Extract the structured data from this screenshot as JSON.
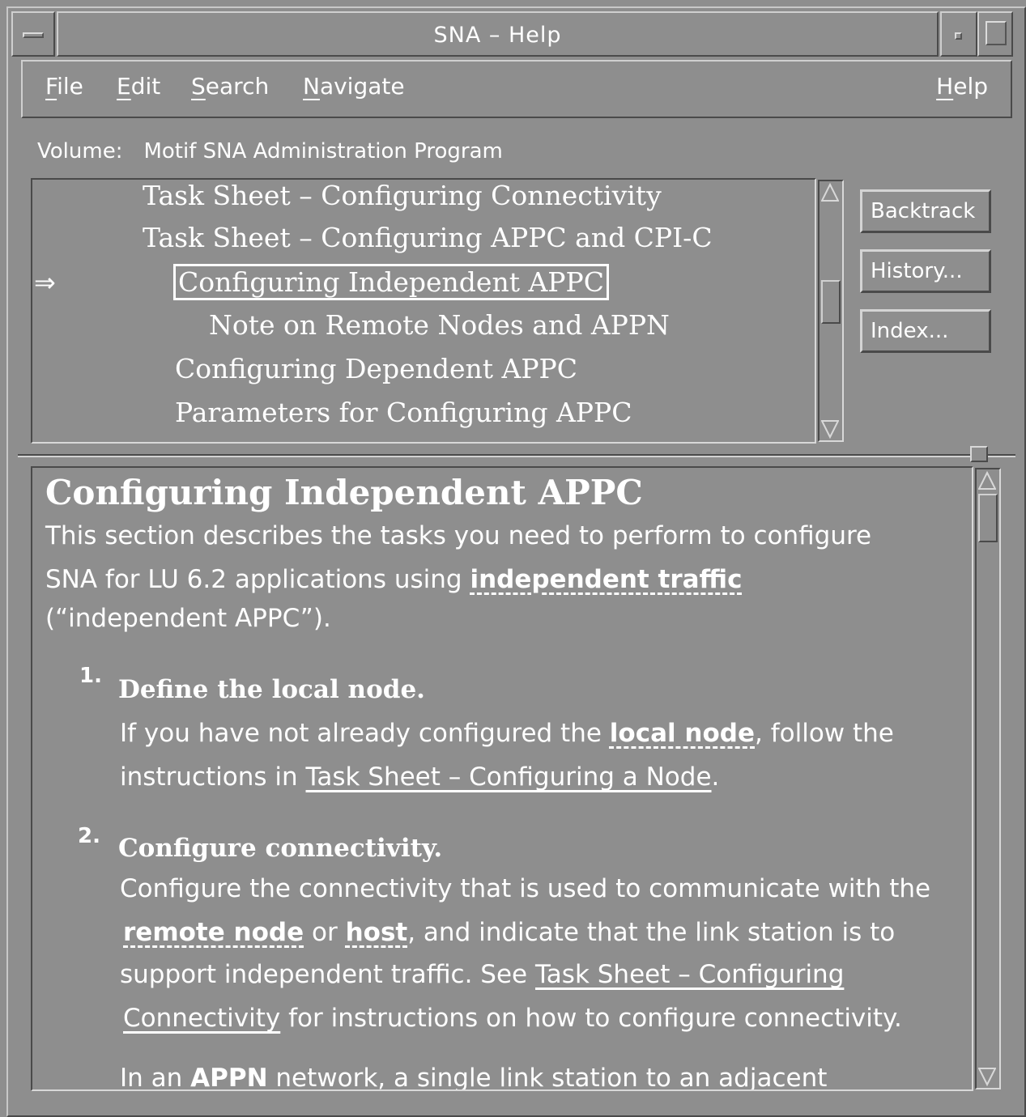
{
  "window": {
    "title": "SNA – Help"
  },
  "menubar": {
    "file": {
      "mn": "F",
      "rest": "ile"
    },
    "edit": {
      "mn": "E",
      "rest": "dit"
    },
    "search": {
      "mn": "S",
      "rest": "earch"
    },
    "navigate": {
      "mn": "N",
      "rest": "avigate"
    },
    "help": {
      "mn": "H",
      "rest": "elp"
    }
  },
  "volume": {
    "label": "Volume:",
    "name": "Motif SNA Administration Program"
  },
  "topics": [
    "Task Sheet – Configuring Connectivity",
    "Task Sheet – Configuring APPC and CPI-C",
    "Configuring Independent APPC",
    "Note on Remote Nodes and APPN",
    "Configuring Dependent APPC",
    "Parameters for Configuring APPC"
  ],
  "current_topic_marker": "⇒",
  "side_buttons": {
    "backtrack": "Backtrack",
    "history": "History...",
    "index": "Index..."
  },
  "content": {
    "heading": "Configuring Independent APPC",
    "intro_1": "This section describes the tasks you need to perform to configure",
    "intro_2a": "SNA for LU 6.2 applications using",
    "intro_2_link": "independent traffic",
    "intro_3": "(“independent APPC”).",
    "step1": {
      "num": "1.",
      "title": "Define the local node.",
      "l1a": "If you have not already configured the",
      "l1_link": "local node",
      "l1b": ", follow the",
      "l2a": "instructions in",
      "l2_link": "Task Sheet – Configuring a Node",
      "l2b": "."
    },
    "step2": {
      "num": "2.",
      "title": "Configure connectivity.",
      "l1": "Configure the connectivity that is used to communicate with the",
      "l2_link1": "remote node",
      "l2_or": "or",
      "l2_link2": "host",
      "l2b": ", and indicate that the link station is to",
      "l3a": "support independent traffic. See",
      "l3_link": "Task Sheet – Configuring",
      "l4_link": "Connectivity",
      "l4b": "for instructions on how to configure connectivity.",
      "l5a": "In an",
      "l5_bold": "APPN",
      "l5b": "network, a single link station to an adjacent"
    }
  }
}
